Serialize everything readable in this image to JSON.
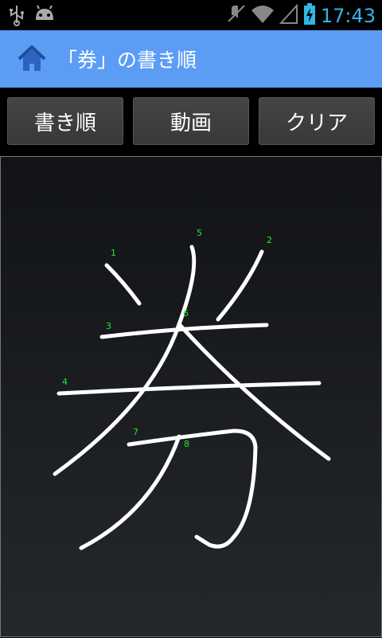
{
  "status": {
    "time": "17:43"
  },
  "header": {
    "title": "「券」の書き順"
  },
  "toolbar": {
    "stroke_order_label": "書き順",
    "video_label": "動画",
    "clear_label": "クリア"
  },
  "canvas": {
    "stroke_numbers": [
      "1",
      "2",
      "3",
      "4",
      "5",
      "6",
      "7",
      "8"
    ]
  }
}
